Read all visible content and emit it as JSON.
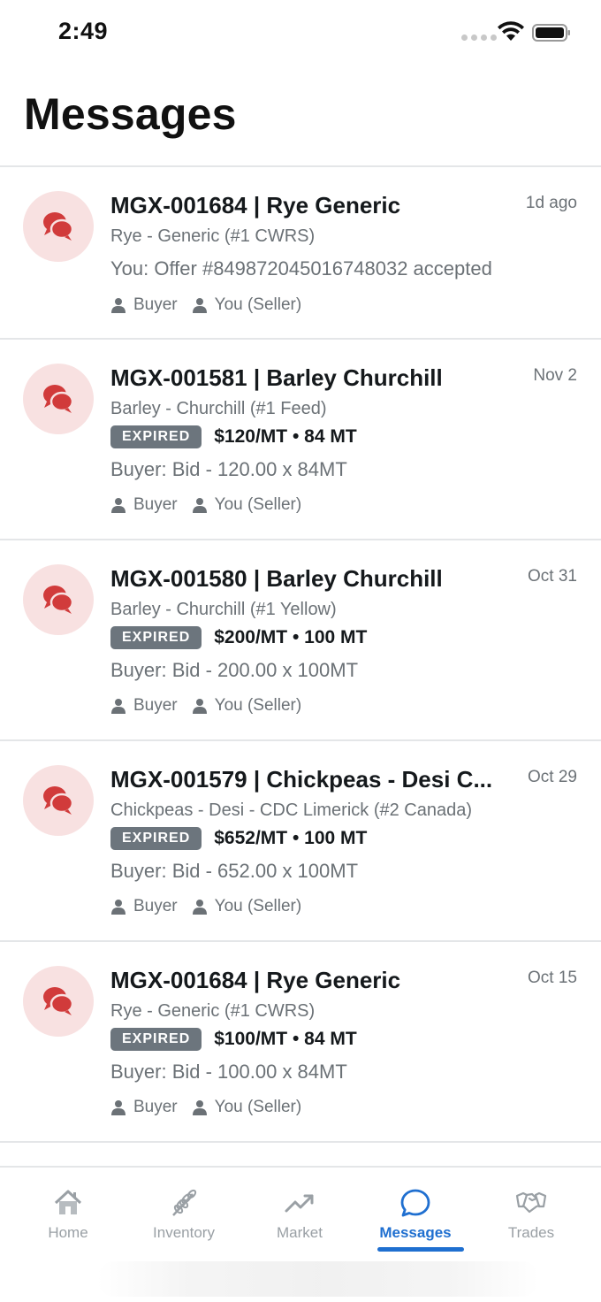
{
  "status_bar": {
    "time": "2:49"
  },
  "header": {
    "title": "Messages"
  },
  "colors": {
    "accent": "#1f6fd0",
    "avatar_bg": "#f8e1e1",
    "avatar_icon": "#d13b3b",
    "badge": "#6c757d"
  },
  "threads": [
    {
      "title": "MGX-001684 | Rye Generic",
      "time": "1d ago",
      "subtitle": "Rye - Generic (#1 CWRS)",
      "last_message": "You: Offer #849872045016748032 accepted",
      "roles": [
        "Buyer",
        "You (Seller)"
      ]
    },
    {
      "title": "MGX-001581 | Barley Churchill",
      "time": "Nov 2",
      "subtitle": "Barley - Churchill (#1 Feed)",
      "status": "EXPIRED",
      "price": "$120/MT • 84 MT",
      "last_message": "Buyer: Bid - 120.00 x 84MT",
      "roles": [
        "Buyer",
        "You (Seller)"
      ]
    },
    {
      "title": "MGX-001580 | Barley Churchill",
      "time": "Oct 31",
      "subtitle": "Barley - Churchill (#1 Yellow)",
      "status": "EXPIRED",
      "price": "$200/MT • 100 MT",
      "last_message": "Buyer: Bid - 200.00 x 100MT",
      "roles": [
        "Buyer",
        "You (Seller)"
      ]
    },
    {
      "title": "MGX-001579 | Chickpeas - Desi C...",
      "time": "Oct 29",
      "subtitle": "Chickpeas - Desi - CDC Limerick (#2 Canada)",
      "status": "EXPIRED",
      "price": "$652/MT • 100 MT",
      "last_message": "Buyer: Bid - 652.00 x 100MT",
      "roles": [
        "Buyer",
        "You (Seller)"
      ]
    },
    {
      "title": "MGX-001684 | Rye Generic",
      "time": "Oct 15",
      "subtitle": "Rye - Generic (#1 CWRS)",
      "status": "EXPIRED",
      "price": "$100/MT • 84 MT",
      "last_message": "Buyer: Bid - 100.00 x 84MT",
      "roles": [
        "Buyer",
        "You (Seller)"
      ]
    }
  ],
  "tabs": [
    {
      "label": "Home",
      "icon": "home-icon"
    },
    {
      "label": "Inventory",
      "icon": "wheat-icon"
    },
    {
      "label": "Market",
      "icon": "trending-up-icon"
    },
    {
      "label": "Messages",
      "icon": "chat-bubble-icon",
      "active": true
    },
    {
      "label": "Trades",
      "icon": "handshake-icon"
    }
  ]
}
